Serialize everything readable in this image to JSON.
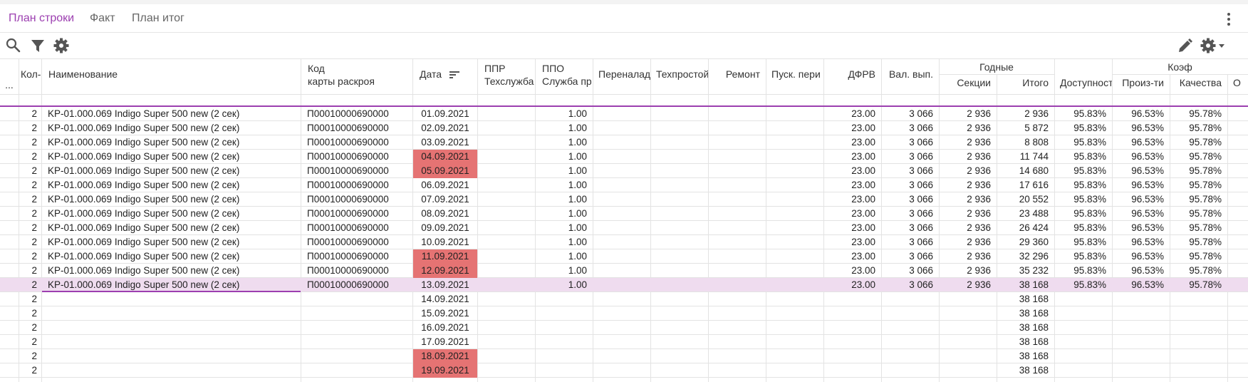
{
  "tabs": [
    {
      "label": "План строки",
      "active": true
    },
    {
      "label": "Факт",
      "active": false
    },
    {
      "label": "План итог",
      "active": false
    }
  ],
  "toolbar": {
    "left_icons": [
      "search-icon",
      "filter-icon",
      "gear-icon"
    ],
    "right_icons": [
      "pencil-icon",
      "gear-dropdown-icon"
    ]
  },
  "colors": {
    "accent": "#9c3fb0",
    "highlight": "#e57373",
    "selected_row": "#efdcef"
  },
  "grid": {
    "group_headers": [
      {
        "label": "Годные"
      },
      {
        "label": "Коэф"
      }
    ],
    "columns": [
      {
        "key": "rownum",
        "label": "...",
        "align": "ctr"
      },
      {
        "key": "kol",
        "label": "Кол-",
        "align": "ctr"
      },
      {
        "key": "name",
        "label": "Наименование",
        "align": "txt"
      },
      {
        "key": "kod",
        "label": "Код",
        "label2": "карты раскроя",
        "align": "txt"
      },
      {
        "key": "date",
        "label": "Дата",
        "align": "ctr",
        "sort_icon": "sort-lines-icon"
      },
      {
        "key": "ppr",
        "label": "ППР",
        "label2": "Техслужба",
        "align": "num"
      },
      {
        "key": "ppo",
        "label": "ППО",
        "label2": "Служба пр",
        "align": "num"
      },
      {
        "key": "perenalad",
        "label": "Переналад",
        "align": "num"
      },
      {
        "key": "tehprostoi",
        "label": "Техпростой",
        "align": "num"
      },
      {
        "key": "remont",
        "label": "Ремонт",
        "align": "num"
      },
      {
        "key": "pusk",
        "label": "Пуск. пери",
        "align": "num"
      },
      {
        "key": "dfrv",
        "label": "ДФРВ",
        "align": "num"
      },
      {
        "key": "valvyp",
        "label": "Вал. вып.",
        "align": "num"
      },
      {
        "key": "sekcii",
        "label": "Секции",
        "align": "num"
      },
      {
        "key": "itogo",
        "label": "Итого",
        "align": "num"
      },
      {
        "key": "dostup",
        "label": "Доступност",
        "align": "num"
      },
      {
        "key": "proiz",
        "label": "Произ-ти",
        "align": "num"
      },
      {
        "key": "kach",
        "label": "Качества",
        "align": "num"
      },
      {
        "key": "o",
        "label": "О",
        "align": "num"
      }
    ],
    "rows": [
      {
        "kol": "2",
        "name": "KP-01.000.069 Indigo Super 500 new (2 сек)",
        "kod": "П00010000690000",
        "date": "01.09.2021",
        "ppo": "1.00",
        "dfrv": "23.00",
        "valvyp": "3 066",
        "sekcii": "2 936",
        "itogo": "2 936",
        "dostup": "95.83%",
        "proiz": "96.53%",
        "kach": "95.78%"
      },
      {
        "kol": "2",
        "name": "KP-01.000.069 Indigo Super 500 new (2 сек)",
        "kod": "П00010000690000",
        "date": "02.09.2021",
        "ppo": "1.00",
        "dfrv": "23.00",
        "valvyp": "3 066",
        "sekcii": "2 936",
        "itogo": "5 872",
        "dostup": "95.83%",
        "proiz": "96.53%",
        "kach": "95.78%"
      },
      {
        "kol": "2",
        "name": "KP-01.000.069 Indigo Super 500 new (2 сек)",
        "kod": "П00010000690000",
        "date": "03.09.2021",
        "ppo": "1.00",
        "dfrv": "23.00",
        "valvyp": "3 066",
        "sekcii": "2 936",
        "itogo": "8 808",
        "dostup": "95.83%",
        "proiz": "96.53%",
        "kach": "95.78%"
      },
      {
        "kol": "2",
        "name": "KP-01.000.069 Indigo Super 500 new (2 сек)",
        "kod": "П00010000690000",
        "date": "04.09.2021",
        "date_hl": true,
        "ppo": "1.00",
        "dfrv": "23.00",
        "valvyp": "3 066",
        "sekcii": "2 936",
        "itogo": "11 744",
        "dostup": "95.83%",
        "proiz": "96.53%",
        "kach": "95.78%"
      },
      {
        "kol": "2",
        "name": "KP-01.000.069 Indigo Super 500 new (2 сек)",
        "kod": "П00010000690000",
        "date": "05.09.2021",
        "date_hl": true,
        "ppo": "1.00",
        "dfrv": "23.00",
        "valvyp": "3 066",
        "sekcii": "2 936",
        "itogo": "14 680",
        "dostup": "95.83%",
        "proiz": "96.53%",
        "kach": "95.78%"
      },
      {
        "kol": "2",
        "name": "KP-01.000.069 Indigo Super 500 new (2 сек)",
        "kod": "П00010000690000",
        "date": "06.09.2021",
        "ppo": "1.00",
        "dfrv": "23.00",
        "valvyp": "3 066",
        "sekcii": "2 936",
        "itogo": "17 616",
        "dostup": "95.83%",
        "proiz": "96.53%",
        "kach": "95.78%"
      },
      {
        "kol": "2",
        "name": "KP-01.000.069 Indigo Super 500 new (2 сек)",
        "kod": "П00010000690000",
        "date": "07.09.2021",
        "ppo": "1.00",
        "dfrv": "23.00",
        "valvyp": "3 066",
        "sekcii": "2 936",
        "itogo": "20 552",
        "dostup": "95.83%",
        "proiz": "96.53%",
        "kach": "95.78%"
      },
      {
        "kol": "2",
        "name": "KP-01.000.069 Indigo Super 500 new (2 сек)",
        "kod": "П00010000690000",
        "date": "08.09.2021",
        "ppo": "1.00",
        "dfrv": "23.00",
        "valvyp": "3 066",
        "sekcii": "2 936",
        "itogo": "23 488",
        "dostup": "95.83%",
        "proiz": "96.53%",
        "kach": "95.78%"
      },
      {
        "kol": "2",
        "name": "KP-01.000.069 Indigo Super 500 new (2 сек)",
        "kod": "П00010000690000",
        "date": "09.09.2021",
        "ppo": "1.00",
        "dfrv": "23.00",
        "valvyp": "3 066",
        "sekcii": "2 936",
        "itogo": "26 424",
        "dostup": "95.83%",
        "proiz": "96.53%",
        "kach": "95.78%"
      },
      {
        "kol": "2",
        "name": "KP-01.000.069 Indigo Super 500 new (2 сек)",
        "kod": "П00010000690000",
        "date": "10.09.2021",
        "ppo": "1.00",
        "dfrv": "23.00",
        "valvyp": "3 066",
        "sekcii": "2 936",
        "itogo": "29 360",
        "dostup": "95.83%",
        "proiz": "96.53%",
        "kach": "95.78%"
      },
      {
        "kol": "2",
        "name": "KP-01.000.069 Indigo Super 500 new (2 сек)",
        "kod": "П00010000690000",
        "date": "11.09.2021",
        "date_hl": true,
        "ppo": "1.00",
        "dfrv": "23.00",
        "valvyp": "3 066",
        "sekcii": "2 936",
        "itogo": "32 296",
        "dostup": "95.83%",
        "proiz": "96.53%",
        "kach": "95.78%"
      },
      {
        "kol": "2",
        "name": "KP-01.000.069 Indigo Super 500 new (2 сек)",
        "kod": "П00010000690000",
        "date": "12.09.2021",
        "date_hl": true,
        "ppo": "1.00",
        "dfrv": "23.00",
        "valvyp": "3 066",
        "sekcii": "2 936",
        "itogo": "35 232",
        "dostup": "95.83%",
        "proiz": "96.53%",
        "kach": "95.78%"
      },
      {
        "kol": "2",
        "name": "KP-01.000.069 Indigo Super 500 new (2 сек)",
        "kod": "П00010000690000",
        "date": "13.09.2021",
        "selected": true,
        "ppo": "1.00",
        "dfrv": "23.00",
        "valvyp": "3 066",
        "sekcii": "2 936",
        "itogo": "38 168",
        "dostup": "95.83%",
        "proiz": "96.53%",
        "kach": "95.78%"
      },
      {
        "kol": "2",
        "date": "14.09.2021",
        "itogo": "38 168"
      },
      {
        "kol": "2",
        "date": "15.09.2021",
        "itogo": "38 168"
      },
      {
        "kol": "2",
        "date": "16.09.2021",
        "itogo": "38 168"
      },
      {
        "kol": "2",
        "date": "17.09.2021",
        "itogo": "38 168"
      },
      {
        "kol": "2",
        "date": "18.09.2021",
        "date_hl": true,
        "itogo": "38 168"
      },
      {
        "kol": "2",
        "date": "19.09.2021",
        "date_hl": true,
        "itogo": "38 168"
      }
    ]
  }
}
